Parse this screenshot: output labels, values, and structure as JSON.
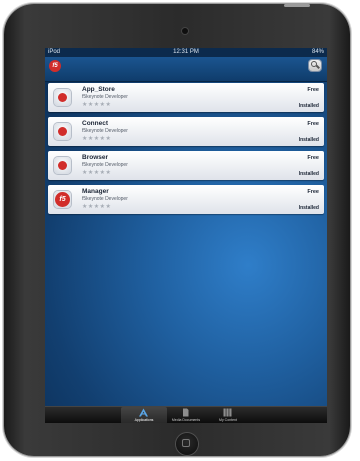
{
  "status_bar": {
    "carrier": "iPod",
    "time": "12:31 PM",
    "battery": "84%"
  },
  "navbar": {
    "logo_text": "f5"
  },
  "apps": [
    {
      "name": "App_Store",
      "developer": "f5keynote Developer",
      "price": "Free",
      "status": "Installed",
      "rating": "★★★★★",
      "icon": "app-store-icon"
    },
    {
      "name": "Connect",
      "developer": "f5keynote Developer",
      "price": "Free",
      "status": "Installed",
      "rating": "★★★★★",
      "icon": "connect-icon"
    },
    {
      "name": "Browser",
      "developer": "f5keynote Developer",
      "price": "Free",
      "status": "Installed",
      "rating": "★★★★★",
      "icon": "browser-icon"
    },
    {
      "name": "Manager",
      "developer": "f5keynote Developer",
      "price": "Free",
      "status": "Installed",
      "rating": "★★★★★",
      "icon": "manager-icon"
    }
  ],
  "tabs": [
    {
      "label": "Applications",
      "selected": true
    },
    {
      "label": "Media Documents",
      "selected": false
    },
    {
      "label": "My Content",
      "selected": false
    }
  ],
  "colors": {
    "brand_red": "#d12d2a",
    "nav_blue": "#1b5590",
    "screen_blue": "#1f5f9f"
  }
}
